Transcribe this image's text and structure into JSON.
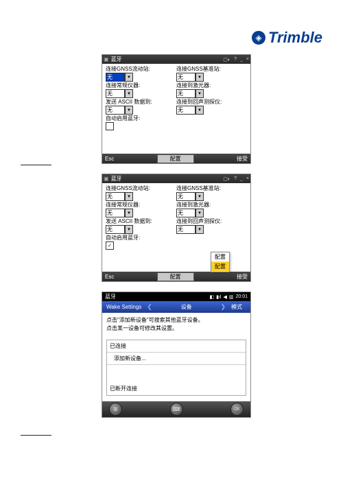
{
  "brand": "Trimble",
  "side_marks": [
    240,
    634
  ],
  "screen1": {
    "title": "蓝牙",
    "fields": {
      "rover_label": "连接GNSS流动站:",
      "rover_value": "无",
      "base_label": "连接GNSS基准站:",
      "base_value": "无",
      "conv_label": "连接常规仪器:",
      "conv_value": "无",
      "laser_label": "连接到激光器:",
      "laser_value": "无",
      "send_label": "发送 ASCII 数据到:",
      "send_value": "无",
      "echo_label": "连接到回声测探仪:",
      "echo_value": "无",
      "auto_label": "自动启用蓝牙:"
    },
    "esc": "Esc",
    "config": "配置",
    "accept": "接受"
  },
  "screen2": {
    "title": "蓝牙",
    "fields": {
      "rover_label": "连接GNSS流动站:",
      "rover_value": "无",
      "base_label": "连接GNSS基准站:",
      "base_value": "无",
      "conv_label": "连接常规仪器:",
      "conv_value": "无",
      "laser_label": "连接到激光器:",
      "laser_value": "无",
      "send_label": "发送 ASCII 数据到:",
      "send_value": "无",
      "echo_label": "连接到回声测探仪:",
      "echo_value": "无",
      "auto_label": "自动启用蓝牙:"
    },
    "checkmark": "✓",
    "esc": "Esc",
    "config": "配置",
    "accept": "接受",
    "popup": {
      "item1": "配置",
      "item2": "配置"
    }
  },
  "screen3": {
    "title": "蓝牙",
    "time": "20:01",
    "tab1": "Wake Settings",
    "tab2": "设备",
    "tab3": "模式",
    "hint1": "点击\"添加新设备\"可搜索其他蓝牙设备。",
    "hint2": "点击某一设备可修改其设置。",
    "list": {
      "connected": "已连接",
      "add": "添加新设备...",
      "disconnected": "已断开连接"
    },
    "ok": "OK"
  }
}
